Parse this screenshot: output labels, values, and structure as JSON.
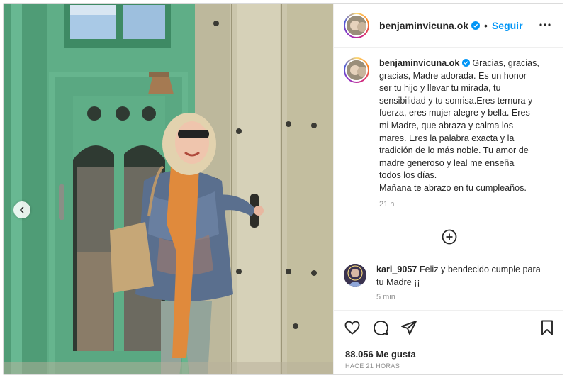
{
  "post": {
    "username": "benjaminvicuna.ok",
    "follow_label": "Seguir",
    "separator": "•",
    "caption_lines": [
      "Gracias, gracias,",
      "gracias, Madre adorada. Es un honor",
      "ser tu hijo y llevar tu mirada, tu",
      "sensibilidad y tu sonrisa.Eres ternura y",
      "fuerza, eres mujer alegre y bella. Eres",
      "mi Madre, que abraza y calma los",
      "mares. Eres la palabra exacta y la",
      "tradición de lo más noble. Tu amor de",
      "madre generoso y leal me enseña",
      "todos los días.",
      "Mañana te abrazo en tu cumpleaños."
    ],
    "caption_time": "21 h",
    "likes": "88.056 Me gusta",
    "posted_ago": "HACE 21 HORAS"
  },
  "comment": {
    "username": "kari_9057",
    "text_line1": "Feliz y bendecido cumple para",
    "text_line2": "tu Madre ¡¡",
    "time": "5 min"
  },
  "icons": {
    "verified": "verified-badge-icon",
    "more": "more-options-icon",
    "add_comment": "add-comment-icon",
    "like": "heart-icon",
    "comment": "comment-icon",
    "share": "share-icon",
    "save": "bookmark-icon",
    "prev": "chevron-left-icon"
  },
  "colors": {
    "accent": "#0095f6",
    "text": "#262626",
    "muted": "#8e8e8e",
    "door_green": "#5fae87"
  }
}
